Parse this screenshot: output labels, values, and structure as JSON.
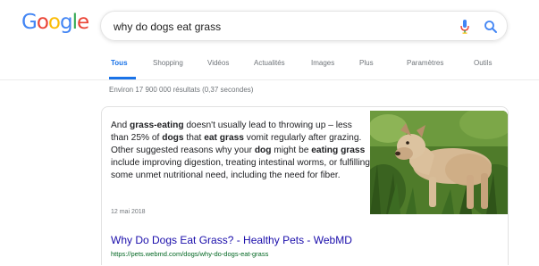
{
  "logo": {
    "letters": [
      {
        "char": "G",
        "color": "#4285f4"
      },
      {
        "char": "o",
        "color": "#ea4335"
      },
      {
        "char": "o",
        "color": "#fbbc05"
      },
      {
        "char": "g",
        "color": "#4285f4"
      },
      {
        "char": "l",
        "color": "#34a853"
      },
      {
        "char": "e",
        "color": "#ea4335"
      }
    ]
  },
  "search": {
    "query": "why do dogs eat grass",
    "icons": [
      "mic-icon",
      "search-icon"
    ]
  },
  "tabs": [
    {
      "label": "Tous",
      "active": true
    },
    {
      "label": "Shopping"
    },
    {
      "label": "Vidéos"
    },
    {
      "label": "Actualités"
    },
    {
      "label": "Images"
    },
    {
      "label": "Plus"
    },
    {
      "label": "Paramètres"
    },
    {
      "label": "Outils"
    }
  ],
  "stats": "Environ 17 900 000 résultats (0,37 secondes)",
  "featured": {
    "snippet_html": "And <b>grass-eating</b> doesn't usually lead to throwing up – less than 25% of <b>dogs</b> that <b>eat grass</b> vomit regularly after grazing. Other suggested reasons why your <b>dog</b> might be <b>eating grass</b> include improving digestion, treating intestinal worms, or fulfilling some unmet nutritional need, including the need for fiber.",
    "date": "12 mai 2018",
    "title": "Why Do Dogs Eat Grass? - Healthy Pets - WebMD",
    "url": "https://pets.webmd.com/dogs/why-do-dogs-eat-grass"
  },
  "colors": {
    "accent": "#1a73e8",
    "link": "#1a0dab",
    "url": "#006621",
    "muted": "#70757a"
  }
}
